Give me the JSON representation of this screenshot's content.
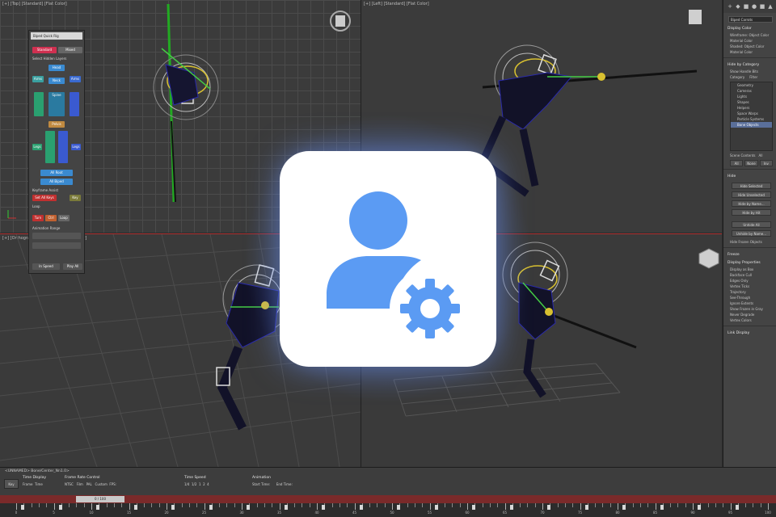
{
  "viewports": {
    "top": {
      "label": "[+] [Top] [Standard] [Flat Color]"
    },
    "left": {
      "label": "[+] [Left] [Standard] [Flat Color]"
    },
    "ortho": {
      "label": "[+] [Orthographic] [Standard] [Flat Color]"
    }
  },
  "biped_panel": {
    "title": "Biped Quick Rig",
    "mode_buttons": [
      "Standard",
      "Mixed"
    ],
    "checkbox": "Select Hidden Layers",
    "buttons": [
      "Head",
      "Neck",
      "Spine",
      "Pelvis",
      "Arms",
      "Legs",
      "All Root",
      "All Biped",
      "Set All Keys",
      "Key",
      "Turn",
      "Ctrl",
      "Loop",
      "In Speed",
      "Play All"
    ],
    "sections": [
      "Keyframe Assist",
      "Loop",
      "Animation Range"
    ]
  },
  "command_panel": {
    "object_name": "Biped Carrots",
    "sections": {
      "display_color": "Display Color",
      "hide_by_category": "Hide by Category",
      "hide": "Hide",
      "freeze": "Freeze",
      "display_properties": "Display Properties",
      "link_display": "Link Display"
    },
    "display_color_rows": [
      "Wireframe: Object Color",
      "Material Color",
      "Shaded: Object Color",
      "Material Color"
    ],
    "hide_by_category_check": "Show Handle Bits",
    "category_tabs": [
      "Category",
      "Filter"
    ],
    "categories": [
      "Geometry",
      "Cameras",
      "Lights",
      "Shapes",
      "Helpers",
      "Space Warps",
      "Particle Systems",
      "Bone Objects"
    ],
    "scene_contents": "Scene Contents",
    "all_label": "All",
    "all_tabs": [
      "All",
      "None",
      "Inv"
    ],
    "hide_buttons": [
      "Hide Selected",
      "Hide Unselected",
      "Hide by Name...",
      "Hide by Hit",
      "Unhide All",
      "Unhide by Name...",
      "Hide Frozen Objects"
    ],
    "display_props": [
      "Display as Box",
      "Backface Cull",
      "Edges Only",
      "Vertex Ticks",
      "Trajectory",
      "See-Through",
      "Ignore Extents",
      "Show Frozen in Gray",
      "Never Degrade",
      "Vertex Colors"
    ]
  },
  "bottom": {
    "path": "<UNNAMED> Bone/Center_Nn1.0>",
    "key_button": "Key",
    "time_display": {
      "title": "Time Display",
      "options": [
        "Frame",
        "Time"
      ]
    },
    "frame_rate": {
      "title": "Frame Rate Control",
      "options": [
        "NTSC",
        "Film",
        "PAL",
        "Custom"
      ],
      "fps_label": "FPS:"
    },
    "time_speed": {
      "title": "Time Speed",
      "options": [
        "1/4",
        "1/2",
        "1",
        "2",
        "4"
      ]
    },
    "animation": {
      "title": "Animation",
      "start": "Start Time:",
      "end": "End Time:"
    },
    "slider_label": "0 / 100",
    "ruler_labels": [
      "0",
      "5",
      "10",
      "15",
      "20",
      "25",
      "30",
      "35",
      "40",
      "45",
      "50",
      "55",
      "60",
      "65",
      "70",
      "75",
      "80",
      "85",
      "90",
      "95",
      "100"
    ]
  },
  "overlay": {
    "icon": "user-settings-icon",
    "color": "#5b9bf3"
  }
}
